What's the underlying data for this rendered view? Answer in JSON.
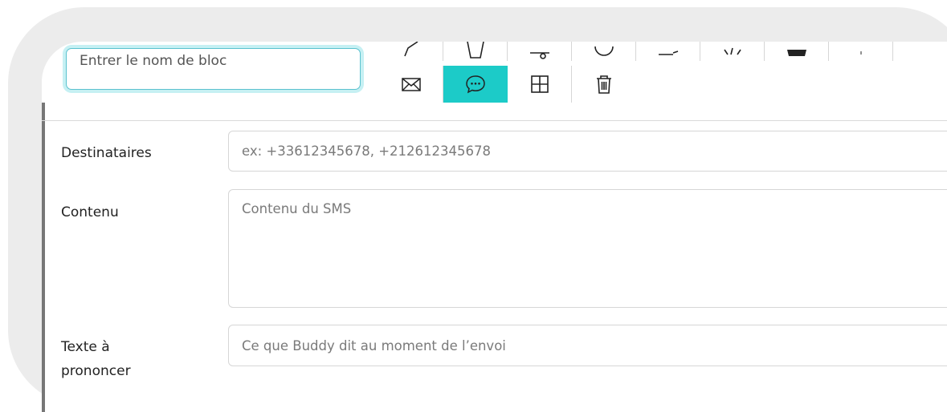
{
  "block_name": {
    "placeholder": "Entrer le nom de bloc"
  },
  "toolbar": {
    "top_row": [
      {
        "icon": "pen-icon"
      },
      {
        "icon": "cup-icon"
      },
      {
        "icon": "slider-icon"
      },
      {
        "icon": "circle-icon"
      },
      {
        "icon": "camera-icon"
      },
      {
        "icon": "code-icon"
      },
      {
        "icon": "folder-icon"
      },
      {
        "icon": "dot-icon"
      }
    ],
    "bottom_row": [
      {
        "icon": "envelope-icon"
      },
      {
        "icon": "chat-bubble-icon",
        "active": true
      },
      {
        "icon": "grid-icon"
      },
      {
        "icon": "trash-icon"
      }
    ],
    "active_color": "#1ccbc8"
  },
  "form": {
    "recipients": {
      "label": "Destinataires",
      "placeholder": "ex: +33612345678, +212612345678"
    },
    "content": {
      "label": "Contenu",
      "placeholder": "Contenu du SMS"
    },
    "speech": {
      "label_line1": "Texte à",
      "label_line2": "prononcer",
      "placeholder": "Ce que Buddy dit au moment de l’envoi"
    }
  }
}
